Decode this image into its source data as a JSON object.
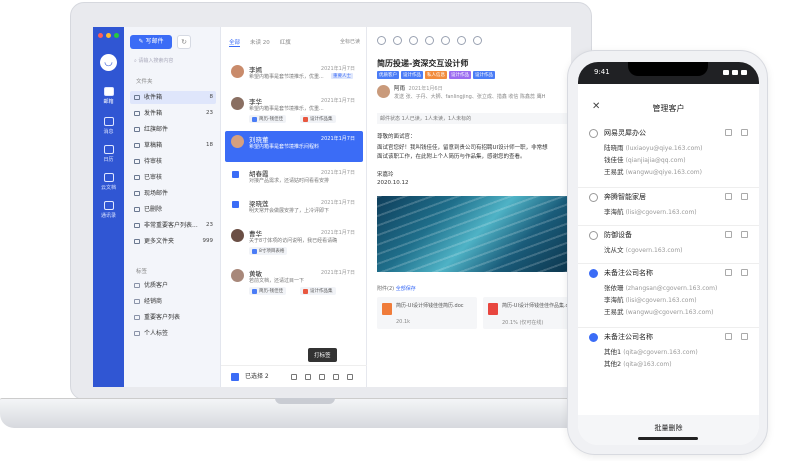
{
  "rail": {
    "items": [
      {
        "label": "邮箱"
      },
      {
        "label": "消息"
      },
      {
        "label": "日历"
      },
      {
        "label": "云文档"
      },
      {
        "label": "通讯录"
      }
    ]
  },
  "folders": {
    "compose_label": "写邮件",
    "search_placeholder": "请输入搜索内容",
    "section_label": "文件夹",
    "items": [
      {
        "label": "收件箱",
        "count": "8"
      },
      {
        "label": "发件箱",
        "count": "23"
      },
      {
        "label": "红旗邮件",
        "count": ""
      },
      {
        "label": "草稿箱",
        "count": "18"
      },
      {
        "label": "待审核",
        "count": ""
      },
      {
        "label": "已审核",
        "count": ""
      },
      {
        "label": "现场邮件",
        "count": ""
      },
      {
        "label": "已删除",
        "count": ""
      },
      {
        "label": "非常重要客户列表...",
        "count": "23"
      },
      {
        "label": "更多文件夹",
        "count": "999"
      }
    ],
    "tags_label": "标签",
    "tags": [
      {
        "label": "优质客户"
      },
      {
        "label": "经销商"
      },
      {
        "label": "重要客户列表"
      },
      {
        "label": "个人标签"
      }
    ]
  },
  "list": {
    "tabs": [
      {
        "label": "全部"
      },
      {
        "label": "未读 20"
      },
      {
        "label": "红旗"
      }
    ],
    "mark_all": "全标已读",
    "mails": [
      {
        "sender": "李嫣",
        "date": "2021年1月7日",
        "summary": "希望内箱事是套节境推乐，优重...",
        "tag": "重要人士",
        "chip1": "",
        "chip2": ""
      },
      {
        "sender": "李华",
        "date": "2021年1月7日",
        "summary": "希望内箱事是套节境推乐，优重...",
        "tag": "",
        "chip1": "简历-钱佳佳",
        "chip2": "设计作品集"
      },
      {
        "sender": "刘晓董",
        "date": "2021年1月7日",
        "summary": "希望内箱事是套节境推乐间程料",
        "tag": "",
        "chip1": "",
        "chip2": ""
      },
      {
        "sender": "胡春霞",
        "date": "2021年1月7日",
        "summary": "对接产品需求，还请姑时间看看安排",
        "tag": "",
        "chip1": "",
        "chip2": ""
      },
      {
        "sender": "梁晓莲",
        "date": "2021年1月7日",
        "summary": "明天常开会做展安排了，上冷评即下",
        "tag": "",
        "chip1": "",
        "chip2": ""
      },
      {
        "sender": "曹华",
        "date": "2021年1月7日",
        "summary": "关于8寸体项的访问说明，我已经看请确",
        "tag": "",
        "chip1": "8寸项目表格",
        "chip2": ""
      },
      {
        "sender": "黄敏",
        "date": "2021年1月7日",
        "summary": "若前文档，还请过目一下",
        "tag": "",
        "chip1": "简历-钱佳佳",
        "chip2": "设计作品集"
      }
    ],
    "selected_label": "已选择 2",
    "tooltip": "打标签"
  },
  "reader": {
    "subject": "简历投递-资深交互设计师",
    "tags": [
      {
        "label": "优质客户",
        "color": "#4a7cf6"
      },
      {
        "label": "设计作品",
        "color": "#4a7cf6"
      },
      {
        "label": "私人信息",
        "color": "#f28b3c"
      },
      {
        "label": "设计作品",
        "color": "#9b6cf0"
      },
      {
        "label": "设计作品",
        "color": "#4a7cf6"
      }
    ],
    "from": "阿雨",
    "from_date": "2021年1月6日",
    "to": "发送 张、子丹、大狮、fanlingjing、张立成、措鑫     收信 陈鑫蕊 鹰H",
    "summary": "邮件状态 1人已读，1人未读，1人未标的",
    "greeting": "尊敬的面试官：",
    "p1": "面试官您好！我叫钱佳佳，留意到贵公司有招聘UI设计师一职，非常想",
    "p2": "面试该职工作，在此附上个人简历与作品集，感谢您的查看。",
    "sign": "宋嘉玲",
    "sign_date": "2020.10.12",
    "attach_header": "附件(2)",
    "attach_all": "全部保存",
    "attachments": [
      {
        "name": "简历-UI设计师钱佳佳简历.doc",
        "size": "20.1k"
      },
      {
        "name": "简历-UI设计师钱佳佳作品集.doc",
        "size": "20.1% (仅可在线)"
      }
    ]
  },
  "phone": {
    "time": "9:41",
    "title": "管理客户",
    "groups": [
      {
        "name": "网易灵犀办公",
        "checked": false,
        "members": [
          {
            "name": "陆晓雨",
            "email": "(luxiaoyu@qiye.163.com)"
          },
          {
            "name": "钱佳佳",
            "email": "(qianjiajia@qq.com)"
          },
          {
            "name": "王易武",
            "email": "(wangwu@qiye.163.com)"
          }
        ]
      },
      {
        "name": "奔腾智能家居",
        "checked": false,
        "members": [
          {
            "name": "李海航",
            "email": "(lisi@cgovern.163.com)"
          }
        ]
      },
      {
        "name": "防御设备",
        "checked": false,
        "members": [
          {
            "name": "沈从文",
            "email": "(cgovern.163.com)"
          }
        ]
      },
      {
        "name": "未备注公司名称",
        "checked": true,
        "members": [
          {
            "name": "张依珊",
            "email": "(zhangsan@cgovern.163.com)"
          },
          {
            "name": "李海航",
            "email": "(lisi@cgovern.163.com)"
          },
          {
            "name": "王易武",
            "email": "(wangwu@cgovern.163.com)"
          }
        ]
      },
      {
        "name": "未备注公司名称",
        "checked": true,
        "members": [
          {
            "name": "其他1",
            "email": "(qita@cgovern.163.com)"
          },
          {
            "name": "其他2",
            "email": "(qita@163.com)"
          }
        ]
      }
    ],
    "footer": "批量删除"
  }
}
